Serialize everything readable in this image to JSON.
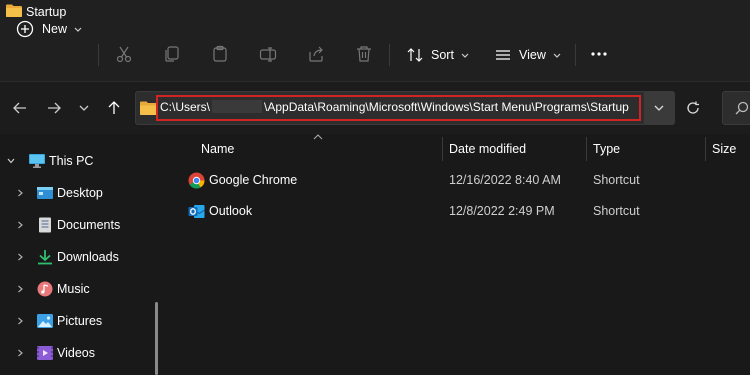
{
  "window": {
    "title": "Startup"
  },
  "toolbar": {
    "new_label": "New",
    "sort_label": "Sort",
    "view_label": "View"
  },
  "address": {
    "prefix": "C:\\Users\\",
    "suffix": "\\AppData\\Roaming\\Microsoft\\Windows\\Start Menu\\Programs\\Startup"
  },
  "nav": {
    "this_pc": "This PC",
    "items": [
      {
        "label": "Desktop",
        "icon": "desktop-icon"
      },
      {
        "label": "Documents",
        "icon": "documents-icon"
      },
      {
        "label": "Downloads",
        "icon": "downloads-icon"
      },
      {
        "label": "Music",
        "icon": "music-icon"
      },
      {
        "label": "Pictures",
        "icon": "pictures-icon"
      },
      {
        "label": "Videos",
        "icon": "videos-icon"
      }
    ]
  },
  "columns": {
    "name": "Name",
    "date": "Date modified",
    "type": "Type",
    "size": "Size"
  },
  "files": [
    {
      "name": "Google Chrome",
      "date": "12/16/2022 8:40 AM",
      "type": "Shortcut",
      "icon": "chrome-icon"
    },
    {
      "name": "Outlook",
      "date": "12/8/2022 2:49 PM",
      "type": "Shortcut",
      "icon": "outlook-icon"
    }
  ],
  "colors": {
    "background": "#191919",
    "toolbar": "#202020",
    "highlight": "#d32424",
    "folder": "#f4c04a"
  }
}
